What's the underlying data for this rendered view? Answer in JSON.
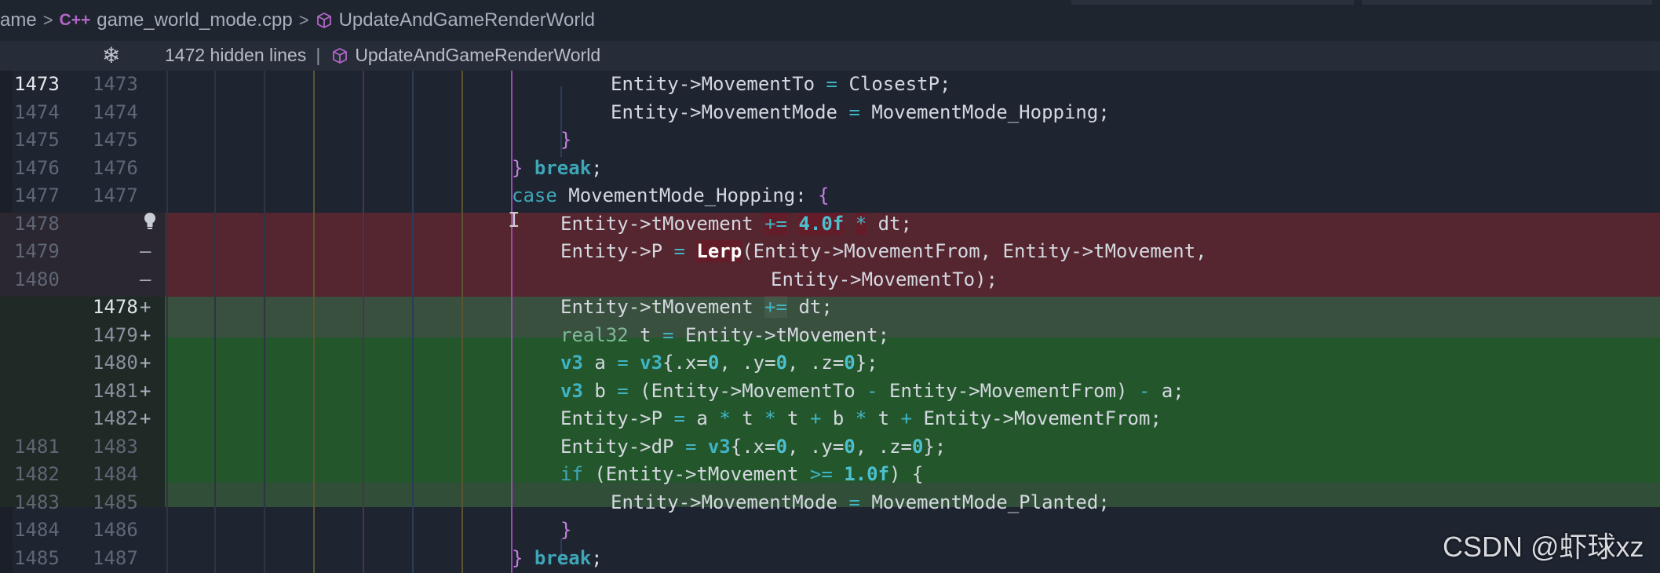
{
  "breadcrumb": {
    "items": [
      {
        "label": "ame",
        "icon": ""
      },
      {
        "label": "game_world_mode.cpp",
        "icon": "cpp-file-icon"
      },
      {
        "label": "UpdateAndGameRenderWorld",
        "icon": "cube-symbol-icon"
      }
    ],
    "separator": ">",
    "cpp_glyph": "C++"
  },
  "sticky": {
    "hidden_lines": "1472 hidden lines",
    "divider": "|",
    "symbol": "UpdateAndGameRenderWorld"
  },
  "lines": [
    {
      "old": "1473",
      "new": "1473",
      "mark": ""
    },
    {
      "old": "1474",
      "new": "1474",
      "mark": ""
    },
    {
      "old": "1475",
      "new": "1475",
      "mark": ""
    },
    {
      "old": "1476",
      "new": "1476",
      "mark": ""
    },
    {
      "old": "1477",
      "new": "1477",
      "mark": ""
    },
    {
      "old": "1478",
      "new": "",
      "mark": ""
    },
    {
      "old": "1479",
      "new": "",
      "mark": "—"
    },
    {
      "old": "1480",
      "new": "",
      "mark": "—"
    },
    {
      "old": "",
      "new": "1478",
      "mark": "+"
    },
    {
      "old": "",
      "new": "1479",
      "mark": "+"
    },
    {
      "old": "",
      "new": "1480",
      "mark": "+"
    },
    {
      "old": "",
      "new": "1481",
      "mark": "+"
    },
    {
      "old": "",
      "new": "1482",
      "mark": "+"
    },
    {
      "old": "1481",
      "new": "1483",
      "mark": ""
    },
    {
      "old": "1482",
      "new": "1484",
      "mark": ""
    },
    {
      "old": "1483",
      "new": "1485",
      "mark": ""
    },
    {
      "old": "1484",
      "new": "1486",
      "mark": ""
    },
    {
      "old": "1485",
      "new": "1487",
      "mark": ""
    }
  ],
  "code": {
    "l1": {
      "a": "Entity->MovementTo ",
      "b": "=",
      "c": " ClosestP;"
    },
    "l2": {
      "a": "Entity->MovementMode ",
      "b": "=",
      "c": " MovementMode_Hopping;"
    },
    "l3": {
      "a": "}"
    },
    "l4": {
      "a": "}",
      "b": "break",
      "c": ";"
    },
    "l5": {
      "a": "case",
      "b": " MovementMode_Hopping: ",
      "c": "{"
    },
    "l6": {
      "a": "Entity->tMovement ",
      "b": "+=",
      "c": "4.0f",
      "d": "*",
      "e": " dt;"
    },
    "l7": {
      "a": "Entity->P ",
      "b": "=",
      "c": "Lerp",
      "d": "(Entity->MovementFrom, Entity->tMovement,"
    },
    "l8": {
      "a": "Entity->MovementTo);"
    },
    "l9": {
      "a": "Entity->tMovement ",
      "b": "+=",
      "c": " dt;"
    },
    "l10": {
      "a": "real32",
      "b": " t ",
      "c": "=",
      "d": " Entity->tMovement;"
    },
    "l11": {
      "a": "v3",
      "b": " a ",
      "c": "=",
      "d": "v3",
      "e": "{.x=",
      "f": "0",
      "g": ", .y=",
      "h": "0",
      "i": ", .z=",
      "j": "0",
      "k": "};"
    },
    "l12": {
      "a": "v3",
      "b": " b ",
      "c": "=",
      "d": " (Entity->MovementTo ",
      "e": "-",
      "f": " Entity->MovementFrom) ",
      "g": "-",
      "h": " a;"
    },
    "l13": {
      "a": "Entity->P ",
      "b": "=",
      "c": " a ",
      "d": "*",
      "e": " t ",
      "f": "*",
      "g": " t ",
      "h": "+",
      "i": " b ",
      "j": "*",
      "k": " t ",
      "l": "+",
      "m": " Entity->MovementFrom;"
    },
    "l14": {
      "a": "Entity->dP ",
      "b": "=",
      "c": "v3",
      "d": "{.x=",
      "e": "0",
      "f": ", .y=",
      "g": "0",
      "h": ", .z=",
      "i": "0",
      "j": "};"
    },
    "l15": {
      "a": "if",
      "b": " (Entity->tMovement ",
      "c": ">=",
      "d": "1.0f",
      "e": ") {"
    },
    "l16": {
      "a": "Entity->MovementMode ",
      "b": "=",
      "c": " MovementMode_Planted;"
    },
    "l17": {
      "a": "}"
    },
    "l18": {
      "a": "}",
      "b": "break",
      "c": ";"
    }
  },
  "gutter_icons": [
    "lightbulb-icon"
  ],
  "watermark": "CSDN @虾球xz",
  "colors": {
    "deleted_bg": "#552530",
    "added_bg": "#24562c",
    "keyword": "#3fa6b8",
    "bracket": "#c67fe0"
  }
}
